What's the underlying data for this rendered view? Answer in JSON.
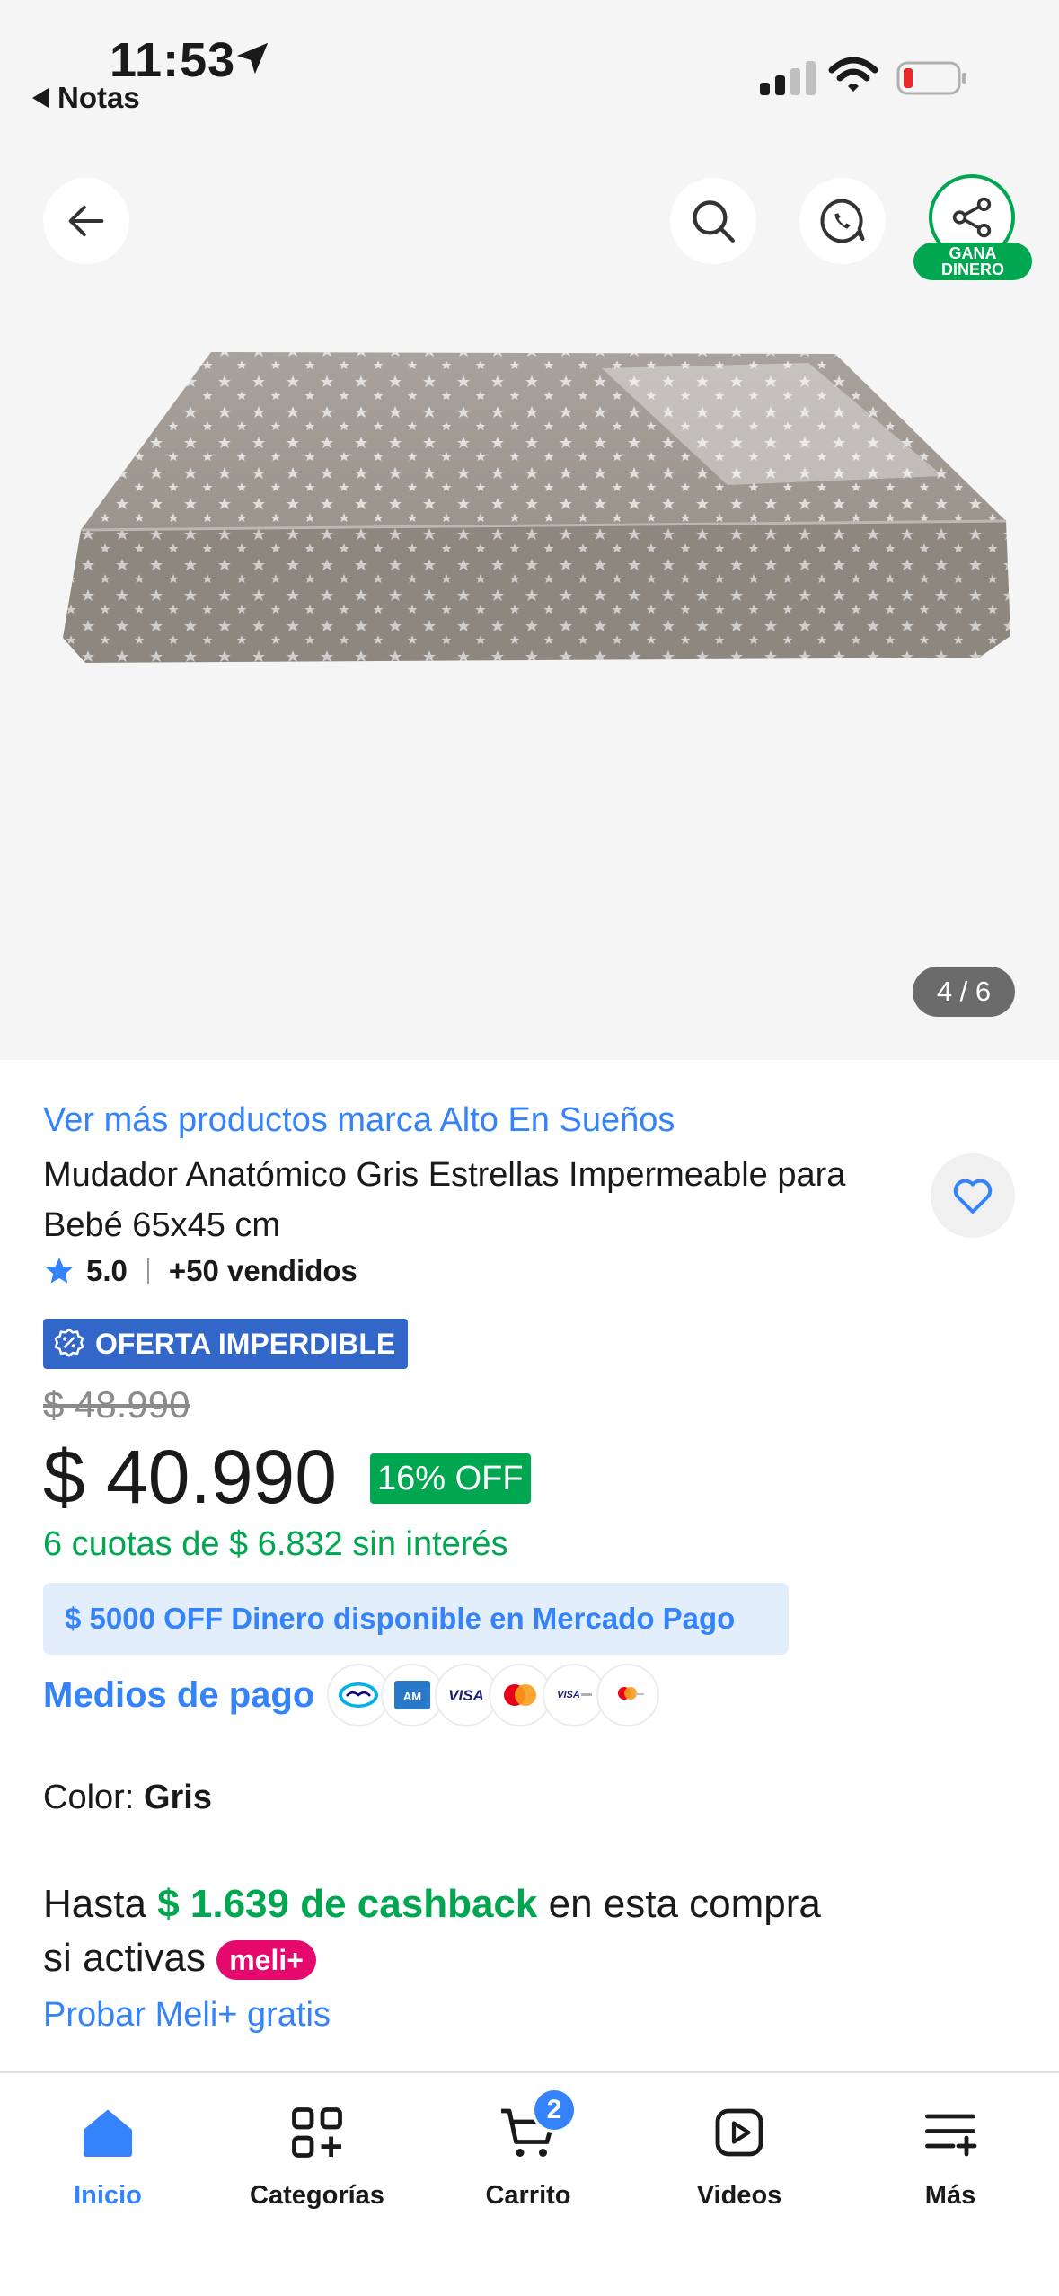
{
  "status_bar": {
    "time": "11:53",
    "back_app": "Notas"
  },
  "gallery": {
    "gana_line1": "GANA",
    "gana_line2": "DINERO",
    "page_indicator": "4 / 6"
  },
  "product": {
    "brand_link": "Ver más productos marca Alto En Sueños",
    "title": "Mudador Anatómico Gris Estrellas Impermeable para Bebé 65x45 cm",
    "rating": "5.0",
    "sold": "+50 vendidos",
    "offer_badge": "OFERTA IMPERDIBLE",
    "old_price": "$ 48.990",
    "price": "$ 40.990",
    "discount": "16% OFF",
    "installments": "6 cuotas de $ 6.832 sin interés",
    "mp_banner": "$ 5000 OFF Dinero disponible en Mercado Pago",
    "payment_label": "Medios de pago",
    "color_label": "Color:",
    "color_value": "Gris",
    "cashback_prefix": "Hasta",
    "cashback_amount": "$ 1.639 de cashback",
    "cashback_suffix": "en esta compra",
    "cashback_line2": "si activas",
    "meli_badge": "meli+",
    "probar": "Probar Meli+ gratis"
  },
  "payment_icons": [
    "mercadopago-icon",
    "amex-icon",
    "visa-icon",
    "mastercard-icon",
    "visa-debit-icon",
    "maestro-icon"
  ],
  "bottom_nav": {
    "items": [
      {
        "label": "Inicio",
        "icon": "home-icon",
        "active": true
      },
      {
        "label": "Categorías",
        "icon": "categories-icon"
      },
      {
        "label": "Carrito",
        "icon": "cart-icon",
        "badge": "2"
      },
      {
        "label": "Videos",
        "icon": "video-icon"
      },
      {
        "label": "Más",
        "icon": "menu-add-icon"
      }
    ]
  },
  "colors": {
    "link_blue": "#3483fa",
    "green": "#00a650",
    "offer_blue": "#3266c8",
    "meli_pink": "#e5096e"
  }
}
